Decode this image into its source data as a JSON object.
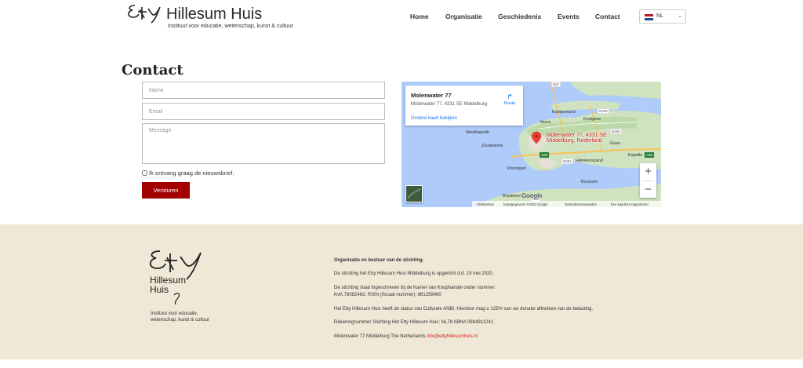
{
  "header": {
    "logo_title": "Hillesum Huis",
    "logo_subtitle": "Instituut voor educatie, wetenschap, kunst & cultuur",
    "nav": [
      {
        "label": "Home"
      },
      {
        "label": "Organisatie"
      },
      {
        "label": "Geschiedenis"
      },
      {
        "label": "Events"
      },
      {
        "label": "Contact"
      }
    ],
    "language": {
      "selected": "NL",
      "flag_colors": [
        "#ae1c28",
        "#ffffff",
        "#21468b"
      ]
    }
  },
  "contact": {
    "title": "Contact",
    "name_placeholder": "Name",
    "email_placeholder": "Email",
    "message_placeholder": "Message",
    "newsletter_label": "Ik ontvang graag de nieuwsbrief,",
    "submit_label": "Versturen",
    "accent_color": "#a30000"
  },
  "map": {
    "info_title": "Molenwater 77",
    "info_address": "Molenwater 77, 4331 SE Middelburg",
    "route_label": "Route",
    "larger_map_link": "Grotere kaart bekijken",
    "pin_label_line1": "Molenwater 77, 4331 SE",
    "pin_label_line2": "Middelburg, Nederland",
    "places": [
      "Westkapelle",
      "Veere",
      "Kamperland",
      "Kortgene",
      "Zoutelande",
      "Vlissingen",
      "Goes",
      "Kapelle",
      "Heinkenszand",
      "Borssele",
      "Breskens"
    ],
    "roads": [
      "N57",
      "N255",
      "N256",
      "N254",
      "A58",
      "A58",
      "N62"
    ],
    "zoom_in": "+",
    "zoom_out": "−",
    "google_mark": "Google",
    "attribution": [
      "Sneltoetsen",
      "Kaartgegevens ©2022 Google",
      "Gebruiksvoorwaarden",
      "Een kaartfout rapporteren"
    ]
  },
  "footer": {
    "logo_line1": "Hillesum",
    "logo_line2": "Huis",
    "logo_sub1": "Instituut voor educatie,",
    "logo_sub2": "wetenschap, kunst & cultuur",
    "heading": "Organisatie en bestuur van de stichting.",
    "p1": "De stichting het Etty Hillesum Huis Middelburg is opgericht d.d. 19 mei 2020.",
    "p2a": "De stichting staat ingeschreven bij de Kamer van Koophandel onder nummer:",
    "p2b": "KvK.78082463. RSIN (fiscaal nummer): 861258460",
    "p3": "Het Etty Hillesum Huis heeft de status van Culturele ANBI. Hierdoor mag u 125% van uw donatie aftrekken van de belasting.",
    "p4": "Rekeningnummer Stichting Het Etty Hillesum Huis: NL78 ABNA 0884911241",
    "p5": "Molenwater 77 Middelburg The Netherlands",
    "email": "info@ettyhillesumhuis.nl",
    "background_color": "#efe8d7"
  }
}
